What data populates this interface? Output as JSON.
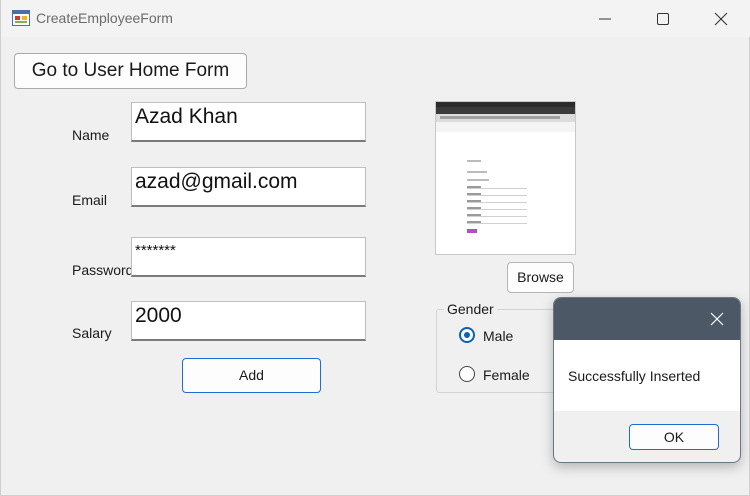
{
  "window": {
    "title": "CreateEmployeeForm"
  },
  "form": {
    "home_button_label": "Go to User Home Form",
    "fields": {
      "name": {
        "label": "Name",
        "value": "Azad Khan"
      },
      "email": {
        "label": "Email",
        "value": "azad@gmail.com"
      },
      "password": {
        "label": "Password",
        "value": "*******"
      },
      "salary": {
        "label": "Salary",
        "value": "2000"
      }
    },
    "add_button_label": "Add",
    "browse_button_label": "Browse",
    "gender": {
      "title": "Gender",
      "options": [
        {
          "label": "Male",
          "checked": true
        },
        {
          "label": "Female",
          "checked": false
        }
      ]
    }
  },
  "dialog": {
    "message": "Successfully Inserted",
    "ok_label": "OK"
  },
  "colors": {
    "accent": "#0a5fb7",
    "dialog_titlebar": "#4d5866",
    "window_bg": "#f0f0f0"
  }
}
